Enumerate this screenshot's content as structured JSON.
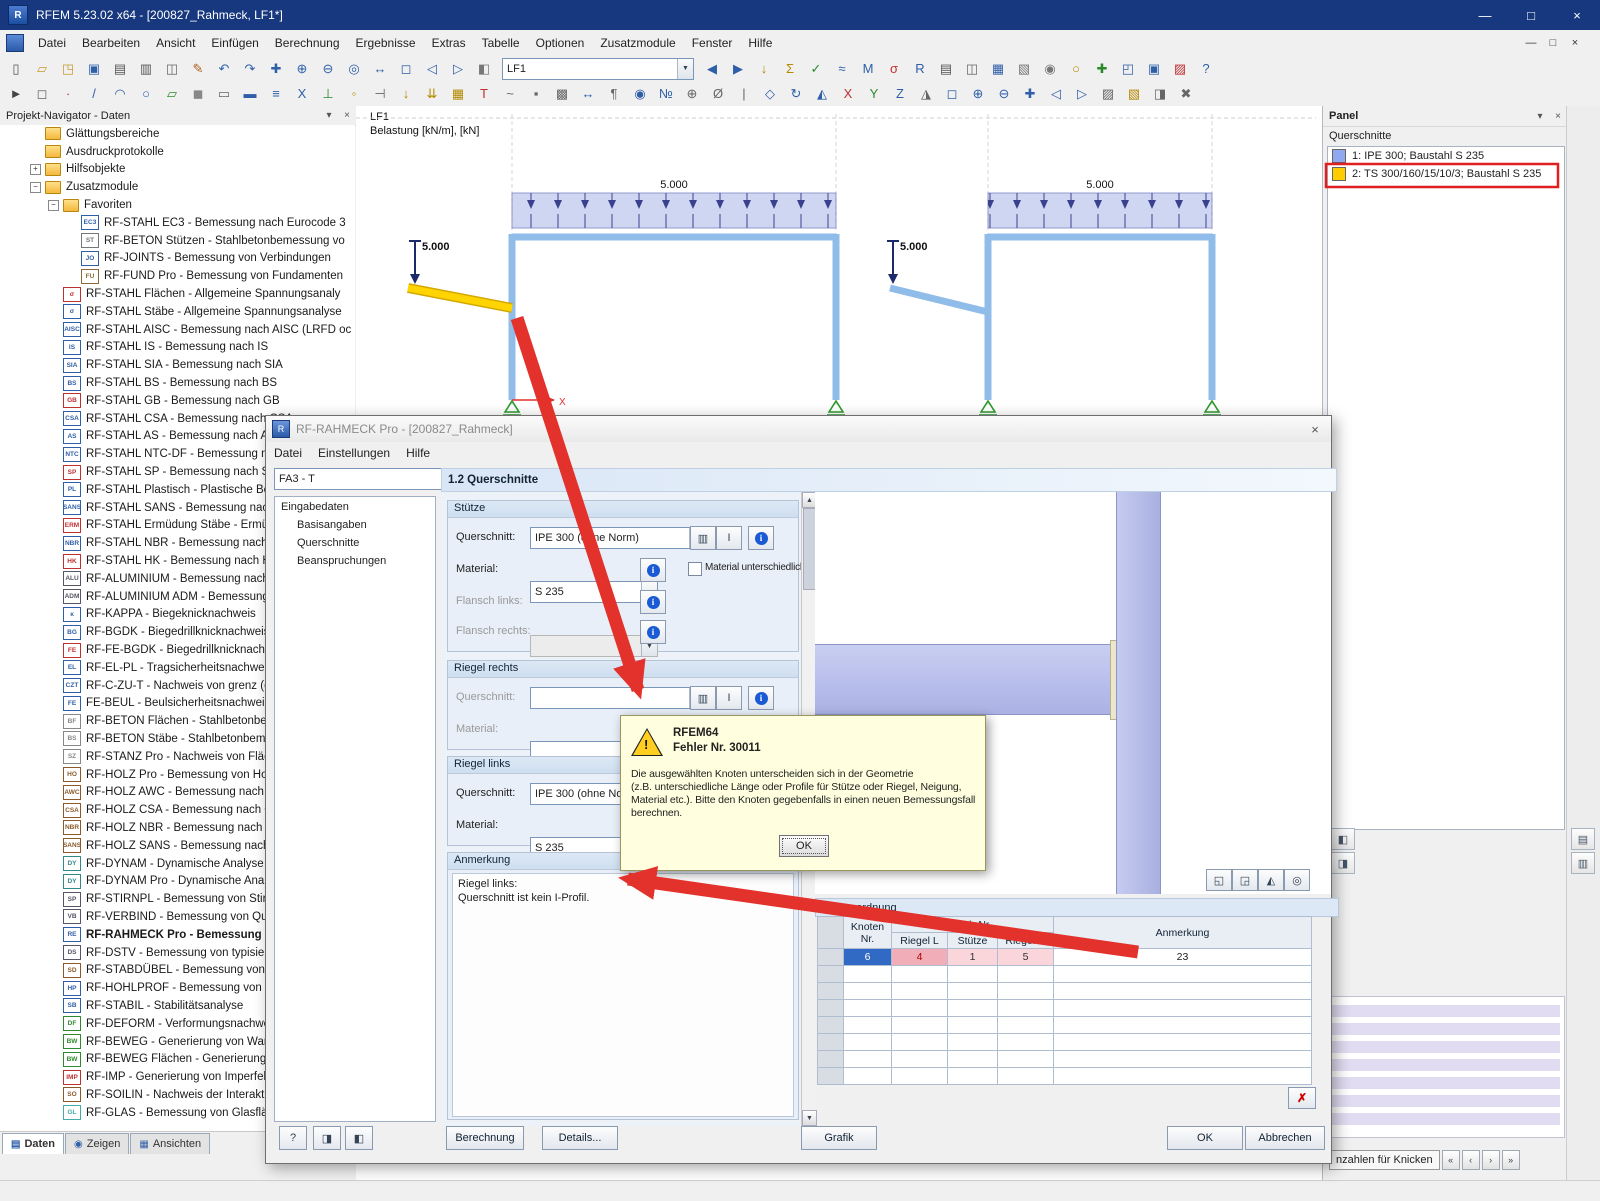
{
  "window": {
    "title": "RFEM 5.23.02 x64 - [200827_Rahmeck, LF1*]",
    "menu": [
      "Datei",
      "Bearbeiten",
      "Ansicht",
      "Einfügen",
      "Berechnung",
      "Ergebnisse",
      "Extras",
      "Tabelle",
      "Optionen",
      "Zusatzmodule",
      "Fenster",
      "Hilfe"
    ]
  },
  "toolbar1": {
    "icons_a": [
      {
        "n": "new-file-icon",
        "g": "▯",
        "c": "#555"
      },
      {
        "n": "open-project-icon",
        "g": "▱",
        "c": "#c89b2a"
      },
      {
        "n": "open-folder-icon",
        "g": "◳",
        "c": "#c89b2a"
      },
      {
        "n": "save-icon",
        "g": "▣",
        "c": "#2f5fa8"
      },
      {
        "n": "print-icon",
        "g": "▤",
        "c": "#555"
      },
      {
        "n": "print-preview-icon",
        "g": "▥",
        "c": "#555"
      },
      {
        "n": "copy-icon",
        "g": "◫",
        "c": "#666"
      },
      {
        "n": "format-brush-icon",
        "g": "✎",
        "c": "#b06020"
      },
      {
        "n": "undo-icon",
        "g": "↶",
        "c": "#2f5fa8"
      },
      {
        "n": "redo-icon",
        "g": "↷",
        "c": "#2f5fa8"
      },
      {
        "n": "crosshair-icon",
        "g": "✚",
        "c": "#2f5fa8"
      },
      {
        "n": "zoom-in-icon",
        "g": "⊕",
        "c": "#2f5fa8"
      },
      {
        "n": "zoom-out-icon",
        "g": "⊖",
        "c": "#2f5fa8"
      },
      {
        "n": "search-icon",
        "g": "◎",
        "c": "#2f5fa8"
      },
      {
        "n": "pan-view-icon",
        "g": "↔",
        "c": "#2f5fa8"
      },
      {
        "n": "full-view-icon",
        "g": "◻",
        "c": "#2f5fa8"
      },
      {
        "n": "previous-view-icon",
        "g": "◁",
        "c": "#2f5fa8"
      },
      {
        "n": "next-view-icon",
        "g": "▷",
        "c": "#2f5fa8"
      },
      {
        "n": "render-mode-icon",
        "g": "◧",
        "c": "#777"
      }
    ],
    "loadcase_value": "LF1",
    "icons_b": [
      {
        "n": "prev-loadcase-icon",
        "g": "◀",
        "c": "#2f5fa8"
      },
      {
        "n": "next-loadcase-icon",
        "g": "▶",
        "c": "#2f5fa8"
      },
      {
        "n": "show-loads-icon",
        "g": "↓",
        "c": "#b58900"
      },
      {
        "n": "results-toggle-icon",
        "g": "Σ",
        "c": "#b58900"
      },
      {
        "n": "result-values-icon",
        "g": "✓",
        "c": "#2a8a2a"
      },
      {
        "n": "deformation-icon",
        "g": "≈",
        "c": "#2f5fa8"
      },
      {
        "n": "internal-forces-icon",
        "g": "M",
        "c": "#2f5fa8"
      },
      {
        "n": "stresses-icon",
        "g": "σ",
        "c": "#c03030"
      },
      {
        "n": "support-forces-icon",
        "g": "R",
        "c": "#2f5fa8"
      },
      {
        "n": "print-graphic-icon",
        "g": "▤",
        "c": "#555"
      },
      {
        "n": "copy-graphic-icon",
        "g": "◫",
        "c": "#666"
      },
      {
        "n": "tables-icon",
        "g": "▦",
        "c": "#2f5fa8"
      },
      {
        "n": "table-toggle-icon",
        "g": "▧",
        "c": "#777"
      },
      {
        "n": "renderer-icon",
        "g": "◉",
        "c": "#777"
      },
      {
        "n": "light-icon",
        "g": "○",
        "c": "#b58900"
      },
      {
        "n": "axes-icon",
        "g": "✚",
        "c": "#2a8a2a"
      },
      {
        "n": "views-icon",
        "g": "◰",
        "c": "#2f5fa8"
      },
      {
        "n": "save-image-icon",
        "g": "▣",
        "c": "#2f5fa8"
      },
      {
        "n": "modules-icon",
        "g": "▨",
        "c": "#c03030"
      },
      {
        "n": "help-icon",
        "g": "?",
        "c": "#2f5fa8"
      }
    ]
  },
  "toolbar2": {
    "icons": [
      {
        "n": "select-icon",
        "g": "►",
        "c": "#444"
      },
      {
        "n": "select-window-icon",
        "g": "◻",
        "c": "#666"
      },
      {
        "n": "node-icon",
        "g": "∙",
        "c": "#c03030"
      },
      {
        "n": "line-icon",
        "g": "/",
        "c": "#2f5fa8"
      },
      {
        "n": "arc-icon",
        "g": "◠",
        "c": "#2f5fa8"
      },
      {
        "n": "circle-icon",
        "g": "○",
        "c": "#2f5fa8"
      },
      {
        "n": "surface-icon",
        "g": "▱",
        "c": "#2a8a2a"
      },
      {
        "n": "solid-icon",
        "g": "◼",
        "c": "#888"
      },
      {
        "n": "opening-icon",
        "g": "▭",
        "c": "#666"
      },
      {
        "n": "member-icon",
        "g": "▬",
        "c": "#2f5fa8"
      },
      {
        "n": "rib-icon",
        "g": "≡",
        "c": "#2f5fa8"
      },
      {
        "n": "truss-icon",
        "g": "X",
        "c": "#2f5fa8"
      },
      {
        "n": "support-icon",
        "g": "⊥",
        "c": "#2a8a2a"
      },
      {
        "n": "hinge-icon",
        "g": "◦",
        "c": "#b58900"
      },
      {
        "n": "eccentricity-icon",
        "g": "⊣",
        "c": "#666"
      },
      {
        "n": "nodal-load-icon",
        "g": "↓",
        "c": "#b58900"
      },
      {
        "n": "member-load-icon",
        "g": "⇊",
        "c": "#b58900"
      },
      {
        "n": "area-load-icon",
        "g": "▦",
        "c": "#b58900"
      },
      {
        "n": "temperature-icon",
        "g": "T",
        "c": "#c03030"
      },
      {
        "n": "imperfection-icon",
        "g": "~",
        "c": "#666"
      },
      {
        "n": "mesh-node-icon",
        "g": "▪",
        "c": "#666"
      },
      {
        "n": "mesh-icon",
        "g": "▩",
        "c": "#666"
      },
      {
        "n": "dimension-icon",
        "g": "↔",
        "c": "#2f5fa8"
      },
      {
        "n": "comment-icon",
        "g": "¶",
        "c": "#666"
      },
      {
        "n": "visibility-icon",
        "g": "◉",
        "c": "#2f5fa8"
      },
      {
        "n": "numbering-icon",
        "g": "№",
        "c": "#2f5fa8"
      },
      {
        "n": "center-icon",
        "g": "⊕",
        "c": "#666"
      },
      {
        "n": "measure-icon",
        "g": "Ø",
        "c": "#666"
      },
      {
        "n": "guide-line-icon",
        "g": "|",
        "c": "#666"
      },
      {
        "n": "work-plane-icon",
        "g": "◇",
        "c": "#2f5fa8"
      },
      {
        "n": "rotate-icon",
        "g": "↻",
        "c": "#2f5fa8"
      },
      {
        "n": "isometric-icon",
        "g": "◭",
        "c": "#2f5fa8"
      },
      {
        "n": "view-x-icon",
        "g": "X",
        "c": "#c03030"
      },
      {
        "n": "view-y-icon",
        "g": "Y",
        "c": "#2a8a2a"
      },
      {
        "n": "view-z-icon",
        "g": "Z",
        "c": "#2f5fa8"
      },
      {
        "n": "perspective-icon",
        "g": "◮",
        "c": "#666"
      },
      {
        "n": "zoom-rect-icon",
        "g": "◻",
        "c": "#2f5fa8"
      },
      {
        "n": "zoom-plus-icon",
        "g": "⊕",
        "c": "#2f5fa8"
      },
      {
        "n": "zoom-minus-icon",
        "g": "⊖",
        "c": "#2f5fa8"
      },
      {
        "n": "move-view-icon",
        "g": "✚",
        "c": "#2f5fa8"
      },
      {
        "n": "prev-view2-icon",
        "g": "◁",
        "c": "#2f5fa8"
      },
      {
        "n": "next-view2-icon",
        "g": "▷",
        "c": "#2f5fa8"
      },
      {
        "n": "display-props-icon",
        "g": "▨",
        "c": "#666"
      },
      {
        "n": "colors-icon",
        "g": "▧",
        "c": "#b58900"
      },
      {
        "n": "select-special-icon",
        "g": "◨",
        "c": "#666"
      },
      {
        "n": "tools-icon",
        "g": "✖",
        "c": "#666"
      }
    ]
  },
  "navigator": {
    "title": "Projekt-Navigator - Daten",
    "tabs": [
      {
        "label": "Daten",
        "g": "▤",
        "k": "active"
      },
      {
        "label": "Zeigen",
        "g": "◉",
        "k": ""
      },
      {
        "label": "Ansichten",
        "g": "▦",
        "k": ""
      }
    ],
    "tree": [
      {
        "l": "Glättungsbereiche",
        "i": "icf",
        "p": "30px"
      },
      {
        "l": "Ausdruckprotokolle",
        "i": "icf",
        "p": "30px"
      },
      {
        "l": "Hilfsobjekte",
        "i": "icf",
        "e": "+",
        "p": "30px"
      },
      {
        "l": "Zusatzmodule",
        "i": "icf",
        "e": "−",
        "p": "30px"
      },
      {
        "l": "Favoriten",
        "i": "icf",
        "e": "−",
        "p": "48px"
      },
      {
        "l": "RF-STAHL EC3 - Bemessung nach Eurocode 3",
        "i": "icb",
        "b": "EC3",
        "c": "#2f5fa8",
        "p": "66px"
      },
      {
        "l": "RF-BETON Stützen - Stahlbetonbemessung vo",
        "i": "icb",
        "b": "ST",
        "c": "#777777",
        "p": "66px"
      },
      {
        "l": "RF-JOINTS - Bemessung von Verbindungen",
        "i": "icb",
        "b": "JO",
        "c": "#2f5fa8",
        "p": "66px"
      },
      {
        "l": "RF-FUND Pro - Bemessung von Fundamenten",
        "i": "icb",
        "b": "FU",
        "c": "#8a6a3a",
        "p": "66px"
      },
      {
        "l": "RF-STAHL Flächen - Allgemeine Spannungsanaly",
        "i": "icb",
        "b": "σ",
        "c": "#c03030",
        "p": "48px"
      },
      {
        "l": "RF-STAHL Stäbe - Allgemeine Spannungsanalyse",
        "i": "icb",
        "b": "σ",
        "c": "#2f5fa8",
        "p": "48px"
      },
      {
        "l": "RF-STAHL AISC - Bemessung nach AISC (LRFD oc",
        "i": "icb",
        "b": "AISC",
        "c": "#2f5fa8",
        "p": "48px"
      },
      {
        "l": "RF-STAHL IS - Bemessung nach IS",
        "i": "icb",
        "b": "IS",
        "c": "#2f5fa8",
        "p": "48px"
      },
      {
        "l": "RF-STAHL SIA - Bemessung nach SIA",
        "i": "icb",
        "b": "SIA",
        "c": "#2f5fa8",
        "p": "48px"
      },
      {
        "l": "RF-STAHL BS - Bemessung nach BS",
        "i": "icb",
        "b": "BS",
        "c": "#2f5fa8",
        "p": "48px"
      },
      {
        "l": "RF-STAHL GB - Bemessung nach GB",
        "i": "icb",
        "b": "GB",
        "c": "#c03030",
        "p": "48px"
      },
      {
        "l": "RF-STAHL CSA - Bemessung nach CSA",
        "i": "icb",
        "b": "CSA",
        "c": "#2f5fa8",
        "p": "48px"
      },
      {
        "l": "RF-STAHL AS - Bemessung nach AS",
        "i": "icb",
        "b": "AS",
        "c": "#2f5fa8",
        "p": "48px"
      },
      {
        "l": "RF-STAHL NTC-DF - Bemessung nach NTC-DF",
        "i": "icb",
        "b": "NTC",
        "c": "#2f5fa8",
        "p": "48px"
      },
      {
        "l": "RF-STAHL SP - Bemessung nach SP",
        "i": "icb",
        "b": "SP",
        "c": "#c03030",
        "p": "48px"
      },
      {
        "l": "RF-STAHL Plastisch - Plastische Bemessung",
        "i": "icb",
        "b": "PL",
        "c": "#2f5fa8",
        "p": "48px"
      },
      {
        "l": "RF-STAHL SANS - Bemessung nach SANS",
        "i": "icb",
        "b": "SANS",
        "c": "#2f5fa8",
        "p": "48px"
      },
      {
        "l": "RF-STAHL Ermüdung Stäbe - Ermüdung",
        "i": "icb",
        "b": "ERM",
        "c": "#c03030",
        "p": "48px"
      },
      {
        "l": "RF-STAHL NBR - Bemessung nach NBR",
        "i": "icb",
        "b": "NBR",
        "c": "#2f5fa8",
        "p": "48px"
      },
      {
        "l": "RF-STAHL HK - Bemessung nach HK",
        "i": "icb",
        "b": "HK",
        "c": "#c03030",
        "p": "48px"
      },
      {
        "l": "RF-ALUMINIUM - Bemessung nach ALU",
        "i": "icb",
        "b": "ALU",
        "c": "#556",
        "p": "48px"
      },
      {
        "l": "RF-ALUMINIUM ADM - Bemessung",
        "i": "icb",
        "b": "ADM",
        "c": "#556",
        "p": "48px"
      },
      {
        "l": "RF-KAPPA - Biegeknicknachweis",
        "i": "icb",
        "b": "κ",
        "c": "#2f5fa8",
        "p": "48px"
      },
      {
        "l": "RF-BGDK - Biegedrillknicknachweis",
        "i": "icb",
        "b": "BG",
        "c": "#2f5fa8",
        "p": "48px"
      },
      {
        "l": "RF-FE-BGDK - Biegedrillknicknachweis",
        "i": "icb",
        "b": "FE",
        "c": "#c03030",
        "p": "48px"
      },
      {
        "l": "RF-EL-PL - Tragsicherheitsnachweis",
        "i": "icb",
        "b": "EL",
        "c": "#2f5fa8",
        "p": "48px"
      },
      {
        "l": "RF-C-ZU-T - Nachweis von grenz (c",
        "i": "icb",
        "b": "CZT",
        "c": "#2f5fa8",
        "p": "48px"
      },
      {
        "l": "FE-BEUL - Beulsicherheitsnachweis",
        "i": "icb",
        "b": "FE",
        "c": "#2f5fa8",
        "p": "48px"
      },
      {
        "l": "RF-BETON Flächen - Stahlbetonbemessung",
        "i": "icb",
        "b": "BF",
        "c": "#888",
        "p": "48px"
      },
      {
        "l": "RF-BETON Stäbe - Stahlbetonbemessung",
        "i": "icb",
        "b": "BS",
        "c": "#888",
        "p": "48px"
      },
      {
        "l": "RF-STANZ Pro - Nachweis von Flächen",
        "i": "icb",
        "b": "SZ",
        "c": "#888",
        "p": "48px"
      },
      {
        "l": "RF-HOLZ Pro - Bemessung von Holz",
        "i": "icb",
        "b": "HO",
        "c": "#8a5a2a",
        "p": "48px"
      },
      {
        "l": "RF-HOLZ AWC - Bemessung nach AWC",
        "i": "icb",
        "b": "AWC",
        "c": "#8a5a2a",
        "p": "48px"
      },
      {
        "l": "RF-HOLZ CSA - Bemessung nach CSA",
        "i": "icb",
        "b": "CSA",
        "c": "#8a5a2a",
        "p": "48px"
      },
      {
        "l": "RF-HOLZ NBR - Bemessung nach NBR",
        "i": "icb",
        "b": "NBR",
        "c": "#8a5a2a",
        "p": "48px"
      },
      {
        "l": "RF-HOLZ SANS - Bemessung nach SANS",
        "i": "icb",
        "b": "SANS",
        "c": "#8a5a2a",
        "p": "48px"
      },
      {
        "l": "RF-DYNAM - Dynamische Analyse",
        "i": "icb",
        "b": "DY",
        "c": "#2f8a8a",
        "p": "48px"
      },
      {
        "l": "RF-DYNAM Pro - Dynamische Analyse",
        "i": "icb",
        "b": "DY",
        "c": "#2f8a8a",
        "p": "48px"
      },
      {
        "l": "RF-STIRNPL - Bemessung von Stirnplatten",
        "i": "icb",
        "b": "SP",
        "c": "#556",
        "p": "48px"
      },
      {
        "l": "RF-VERBIND - Bemessung von Que",
        "i": "icb",
        "b": "VB",
        "c": "#556",
        "p": "48px"
      },
      {
        "l": "RF-RAHMECK Pro - Bemessung v",
        "i": "icb",
        "b": "RE",
        "c": "#2f5fa8",
        "p": "48px",
        "k": "bold"
      },
      {
        "l": "RF-DSTV - Bemessung von typisiert",
        "i": "icb",
        "b": "DS",
        "c": "#556",
        "p": "48px"
      },
      {
        "l": "RF-STABDÜBEL - Bemessung von S",
        "i": "icb",
        "b": "SD",
        "c": "#8a5a2a",
        "p": "48px"
      },
      {
        "l": "RF-HOHLPROF - Bemessung von H",
        "i": "icb",
        "b": "HP",
        "c": "#2f5fa8",
        "p": "48px"
      },
      {
        "l": "RF-STABIL - Stabilitätsanalyse",
        "i": "icb",
        "b": "SB",
        "c": "#2f5fa8",
        "p": "48px"
      },
      {
        "l": "RF-DEFORM - Verformungsnachwe",
        "i": "icb",
        "b": "DF",
        "c": "#2f8a2f",
        "p": "48px"
      },
      {
        "l": "RF-BEWEG - Generierung von Wan",
        "i": "icb",
        "b": "BW",
        "c": "#2f8a2f",
        "p": "48px"
      },
      {
        "l": "RF-BEWEG Flächen - Generierung v",
        "i": "icb",
        "b": "BW",
        "c": "#2f8a2f",
        "p": "48px"
      },
      {
        "l": "RF-IMP - Generierung von Imperfel",
        "i": "icb",
        "b": "IMP",
        "c": "#c03030",
        "p": "48px"
      },
      {
        "l": "RF-SOILIN - Nachweis der Interakti",
        "i": "icb",
        "b": "SO",
        "c": "#8a5a2a",
        "p": "48px"
      },
      {
        "l": "RF-GLAS - Bemessung von Glasflä",
        "i": "icb",
        "b": "GL",
        "c": "#44aaaa",
        "p": "48px"
      }
    ]
  },
  "graphics": {
    "loadcase_label": "LF1",
    "subtitle": "Belastung [kN/m], [kN]",
    "loads": [
      "5.000",
      "5.000",
      "5.000",
      "5.000"
    ],
    "axis_x": "X"
  },
  "panel": {
    "title": "Panel",
    "section": "Querschnitte",
    "items": [
      {
        "l": "1: IPE 300; Baustahl S 235",
        "c": "#8fa8f0"
      },
      {
        "l": "2: TS 300/160/15/10/3; Baustahl S 235",
        "c": "#ffcc00"
      }
    ],
    "bottom_label": "nzahlen für Knicken"
  },
  "dialog": {
    "title": "RF-RAHMECK Pro - [200827_Rahmeck]",
    "menu": [
      "Datei",
      "Einstellungen",
      "Hilfe"
    ],
    "case_value": "FA3 - T",
    "section_header": "1.2 Querschnitte",
    "nav": {
      "root": "Eingabedaten",
      "items": [
        "Basisangaben",
        "Querschnitte",
        "Beanspruchungen"
      ]
    },
    "labels": {
      "querschnitt": "Querschnitt:",
      "material": "Material:",
      "flansch_links": "Flansch links:",
      "flansch_rechts": "Flansch rechts:",
      "material_unterschiedlich": "Material unterschiedlich"
    },
    "groups": {
      "stuetze": "Stütze",
      "riegel_rechts": "Riegel rechts",
      "riegel_links": "Riegel links",
      "anmerkung": "Anmerkung"
    },
    "values": {
      "stuetze_querschnitt": "IPE 300 (ohne Norm)",
      "stuetze_material": "S 235",
      "riegel_links_querschnitt": "IPE 300 (ohne No",
      "riegel_links_material": "S 235"
    },
    "note_lines": [
      "Riegel links:",
      "Querschnitt ist kein I-Profil."
    ],
    "table": {
      "caption": "Stabzuordnung",
      "h_knoten": "Knoten",
      "h_nr": "Nr.",
      "h_stab": "Stab-Nr.",
      "h_riegel_l": "Riegel L",
      "h_stuetze": "Stütze",
      "h_riegel_r": "Riegel R",
      "h_anmerkung": "Anmerkung",
      "row": {
        "knoten": "6",
        "riegel_l": "4",
        "stuetze": "1",
        "riegel_r": "5",
        "anmerkung": "23"
      }
    },
    "buttons": {
      "berechnung": "Berechnung",
      "details": "Details...",
      "grafik": "Grafik",
      "ok": "OK",
      "abbrechen": "Abbrechen"
    }
  },
  "error": {
    "title": "RFEM64",
    "code": "Fehler Nr. 30011",
    "lines": [
      "Die ausgewählten Knoten unterscheiden sich in der Geometrie",
      "(z.B. unterschiedliche Länge oder Profile für Stütze oder Riegel, Neigung,",
      "Material etc.). Bitte den Knoten gegebenfalls in einen neuen Bemessungsfall",
      "berechnen."
    ],
    "ok": "OK"
  }
}
